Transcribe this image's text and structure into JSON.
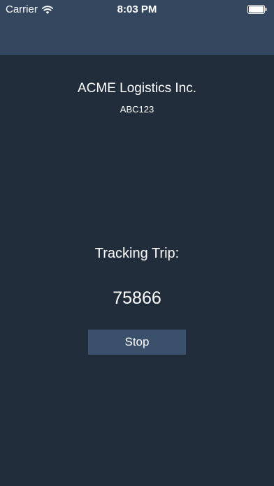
{
  "status_bar": {
    "carrier": "Carrier",
    "time": "8:03 PM",
    "wifi_icon": "wifi-icon",
    "battery_icon": "battery-full-icon"
  },
  "header": {
    "company_name": "ACME Logistics Inc.",
    "company_code": "ABC123"
  },
  "tracking": {
    "label": "Tracking Trip:",
    "trip_number": "75866",
    "stop_label": "Stop"
  },
  "colors": {
    "background": "#212d3a",
    "top_bar": "#34475f",
    "button": "#3a506b",
    "text": "#ffffff"
  }
}
